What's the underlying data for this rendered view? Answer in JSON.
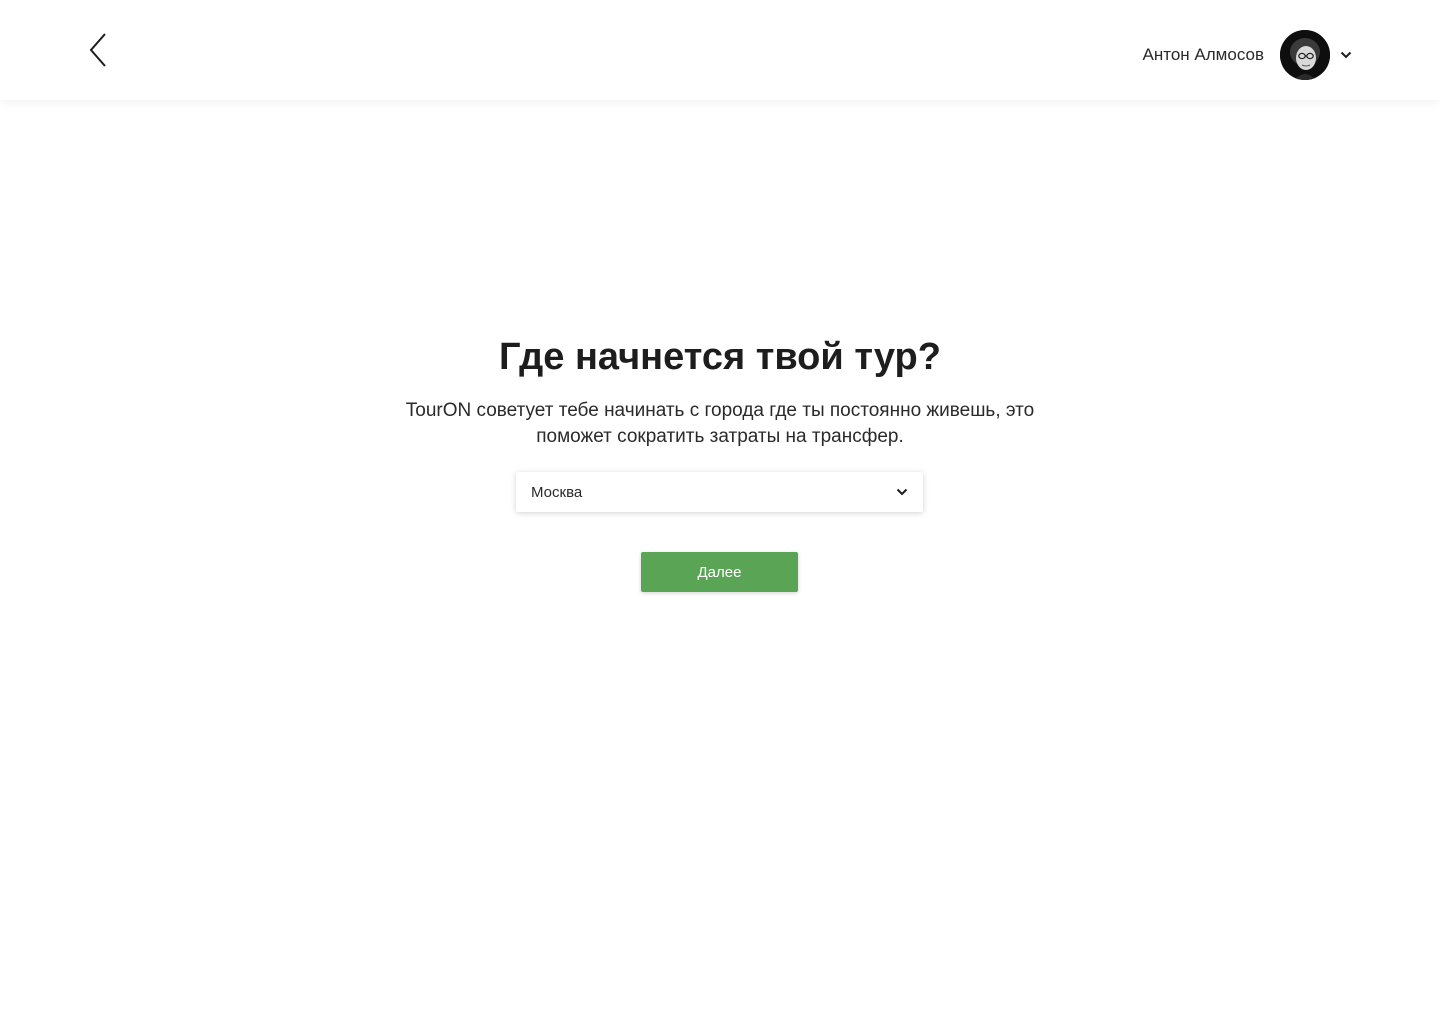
{
  "header": {
    "user_name": "Антон Алмосов"
  },
  "main": {
    "title": "Где начнется твой тур?",
    "subtitle": "TourON советует тебе начинать с города где ты постоянно живешь, это поможет сократить затраты на трансфер.",
    "city_select": {
      "value": "Москва"
    },
    "next_label": "Далее"
  },
  "colors": {
    "accent_green": "#5aa555",
    "text_dark": "#1d1d1d",
    "background": "#ffffff"
  },
  "icons": {
    "back": "chevron-left-icon",
    "user_menu": "chevron-down-icon",
    "select": "chevron-down-icon"
  }
}
